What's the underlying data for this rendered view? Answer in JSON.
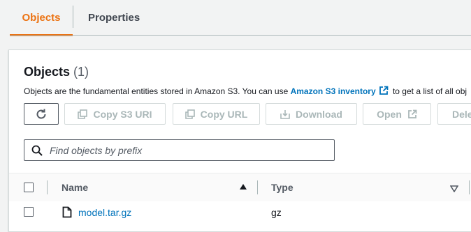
{
  "tabs": [
    {
      "label": "Objects",
      "active": true
    },
    {
      "label": "Properties",
      "active": false
    }
  ],
  "panel": {
    "title": "Objects",
    "count": "(1)",
    "description_prefix": "Objects are the fundamental entities stored in Amazon S3. You can use",
    "description_link": "Amazon S3 inventory",
    "description_suffix": "to get a list of all obj"
  },
  "toolbar": {
    "refresh_icon": "refresh-icon",
    "copy_s3_uri": "Copy S3 URI",
    "copy_url": "Copy URL",
    "download": "Download",
    "open": "Open",
    "delete": "Dele"
  },
  "search": {
    "placeholder": "Find objects by prefix",
    "value": ""
  },
  "table": {
    "columns": [
      "Name",
      "Type"
    ],
    "rows": [
      {
        "name": "model.tar.gz",
        "type": "gz"
      }
    ]
  },
  "colors": {
    "accent": "#ec7211",
    "link": "#0073bb",
    "disabled": "#aab7b8"
  }
}
